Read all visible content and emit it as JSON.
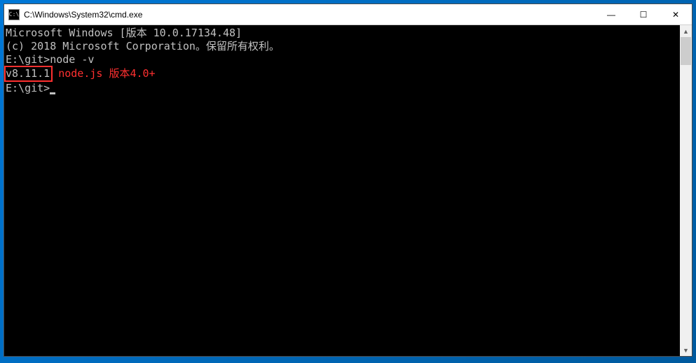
{
  "titlebar": {
    "icon_label": "C:\\",
    "path": "C:\\Windows\\System32\\cmd.exe"
  },
  "window_controls": {
    "minimize": "—",
    "maximize": "☐",
    "close": "✕"
  },
  "terminal": {
    "line1": "Microsoft Windows [版本 10.0.17134.48]",
    "line2": "(c) 2018 Microsoft Corporation。保留所有权利。",
    "blank": "",
    "prompt1_path": "E:\\git>",
    "prompt1_cmd": "node -v",
    "output_version": "v8.11.1",
    "annotation": "node.js 版本4.0+",
    "prompt2_path": "E:\\git>"
  },
  "scrollbar": {
    "up": "▲",
    "down": "▼"
  }
}
